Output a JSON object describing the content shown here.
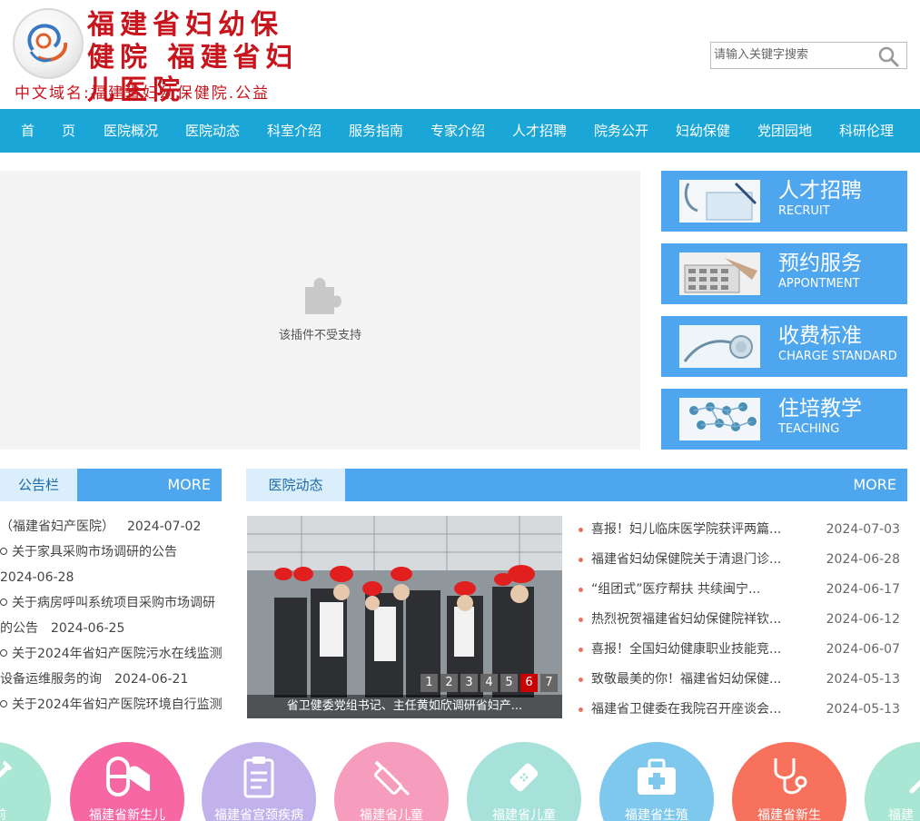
{
  "header": {
    "logo_title": "福建省妇幼保健院 福建省妇儿医院",
    "domain": "中文域名:福建省妇幼保健院.公益"
  },
  "search": {
    "placeholder": "请输入关键字搜索"
  },
  "nav": {
    "items": [
      "首　　页",
      "医院概况",
      "医院动态",
      "科室介绍",
      "服务指南",
      "专家介绍",
      "人才招聘",
      "院务公开",
      "妇幼保健",
      "党团园地",
      "科研伦理"
    ]
  },
  "plugin": {
    "message": "该插件不受支持"
  },
  "side_cards": [
    {
      "title": "人才招聘",
      "subtitle": "RECRUIT",
      "icon": "stethoscope-clipboard-icon"
    },
    {
      "title": "预约服务",
      "subtitle": "APPONTMENT",
      "icon": "calculator-icon"
    },
    {
      "title": "收费标准",
      "subtitle": "CHARGE STANDARD",
      "icon": "stethoscope-icon"
    },
    {
      "title": "住培教学",
      "subtitle": "TEACHING",
      "icon": "medical-network-icon"
    }
  ],
  "notice": {
    "label": "公告栏",
    "more": "MORE",
    "lines": [
      {
        "bullet": false,
        "text": "（福建省妇产医院）",
        "date": "2024-07-02"
      },
      {
        "bullet": true,
        "text": "关于家具采购市场调研的公告",
        "date": ""
      },
      {
        "bullet": false,
        "text": "2024-06-28",
        "date": ""
      },
      {
        "bullet": true,
        "text": "关于病房呼叫系统项目采购市场调研",
        "date": ""
      },
      {
        "bullet": false,
        "text": "的公告",
        "date": "2024-06-25"
      },
      {
        "bullet": true,
        "text": "关于2024年省妇产医院污水在线监测",
        "date": ""
      },
      {
        "bullet": false,
        "text": "设备运维服务的询",
        "date": "2024-06-21"
      },
      {
        "bullet": true,
        "text": "关于2024年省妇产医院环境自行监测",
        "date": ""
      }
    ]
  },
  "news": {
    "label": "医院动态",
    "more": "MORE",
    "photo_caption": "省卫健委党组书记、主任黄如欣调研省妇产...",
    "pager": [
      "1",
      "2",
      "3",
      "4",
      "5",
      "6",
      "7"
    ],
    "pager_active": 6,
    "items": [
      {
        "title": "喜报！妇儿临床医学院获评两篇...",
        "date": "2024-07-03"
      },
      {
        "title": "福建省妇幼保健院关于清退门诊...",
        "date": "2024-06-28"
      },
      {
        "title": "“组团式”医疗帮扶 共续闽宁...",
        "date": "2024-06-17"
      },
      {
        "title": "热烈祝贺福建省妇幼保健院祥钦...",
        "date": "2024-06-12"
      },
      {
        "title": "喜报！全国妇幼健康职业技能竞...",
        "date": "2024-06-07"
      },
      {
        "title": "致敬最美的你！福建省妇幼保健...",
        "date": "2024-05-13"
      },
      {
        "title": "福建省卫健委在我院召开座谈会...",
        "date": "2024-05-13"
      }
    ]
  },
  "circles": [
    {
      "label": "产前",
      "color": "#a9e6d3",
      "icon": "syringe-icon"
    },
    {
      "label": "福建省新生儿",
      "color": "#f667a3",
      "icon": "capsule-icon"
    },
    {
      "label": "福建省宫颈疾病",
      "color": "#c1b2ec",
      "icon": "clipboard-icon"
    },
    {
      "label": "福建省儿童",
      "color": "#f69cbc",
      "icon": "syringe-icon"
    },
    {
      "label": "福建省儿童",
      "color": "#a7e2da",
      "icon": "bandage-icon"
    },
    {
      "label": "福建省生殖",
      "color": "#7dc8ec",
      "icon": "medical-kit-icon"
    },
    {
      "label": "福建省新生",
      "color": "#f7715d",
      "icon": "stethoscope-icon"
    },
    {
      "label": "福建",
      "color": "#a9e6d3",
      "icon": "syringe-icon"
    }
  ]
}
